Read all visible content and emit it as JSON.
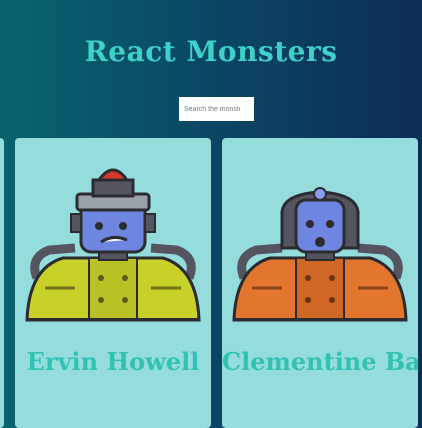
{
  "header": {
    "title": "React Monsters"
  },
  "search": {
    "placeholder": "Search the monster"
  },
  "monsters": [
    {
      "name": "Ervin Howell"
    },
    {
      "name": "Clementine Bauch"
    }
  ],
  "colors": {
    "title": "#3fd0c8",
    "card_bg": "#95dcdc",
    "name_text": "#32c2b3"
  }
}
